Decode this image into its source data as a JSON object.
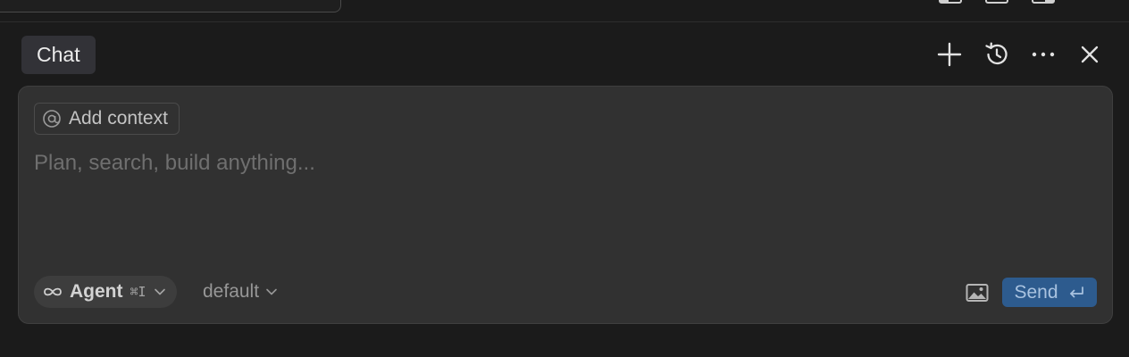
{
  "header": {
    "tab_label": "Chat",
    "actions": [
      {
        "name": "new-chat",
        "icon": "plus-icon"
      },
      {
        "name": "history",
        "icon": "history-icon"
      },
      {
        "name": "more",
        "icon": "ellipsis-icon"
      },
      {
        "name": "close",
        "icon": "close-icon"
      }
    ]
  },
  "composer": {
    "context_button_label": "Add context",
    "context_icon": "at-sign-icon",
    "placeholder": "Plan, search, build anything...",
    "value": "",
    "mode": {
      "icon": "infinity-icon",
      "label": "Agent",
      "shortcut": "⌘I"
    },
    "model_selected": "default",
    "image_icon": "image-icon",
    "send_label": "Send",
    "send_icon": "return-key-icon"
  },
  "colors": {
    "background": "#1b1b1b",
    "composer": "#313131",
    "send_button": "#2d5b8e",
    "send_text": "#a9c3e0"
  }
}
